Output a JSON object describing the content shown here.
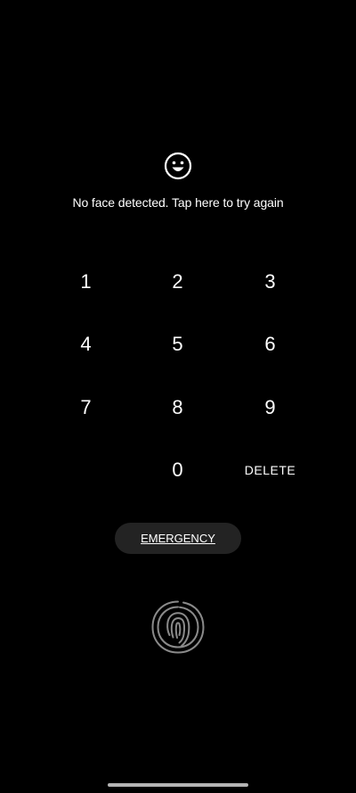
{
  "lockscreen": {
    "face_icon": "smiley-face-icon",
    "face_message": "No face detected. Tap here to try again",
    "keypad": {
      "keys": [
        "1",
        "2",
        "3",
        "4",
        "5",
        "6",
        "7",
        "8",
        "9",
        "0"
      ],
      "delete_label": "DELETE"
    },
    "emergency_label": "EMERGENCY",
    "fingerprint_icon": "fingerprint-icon"
  },
  "colors": {
    "background": "#000000",
    "text": "#ffffff",
    "emergency_bg": "#232323",
    "fingerprint_stroke": "#8a8a8a",
    "nav_handle": "#b4b4b4"
  }
}
